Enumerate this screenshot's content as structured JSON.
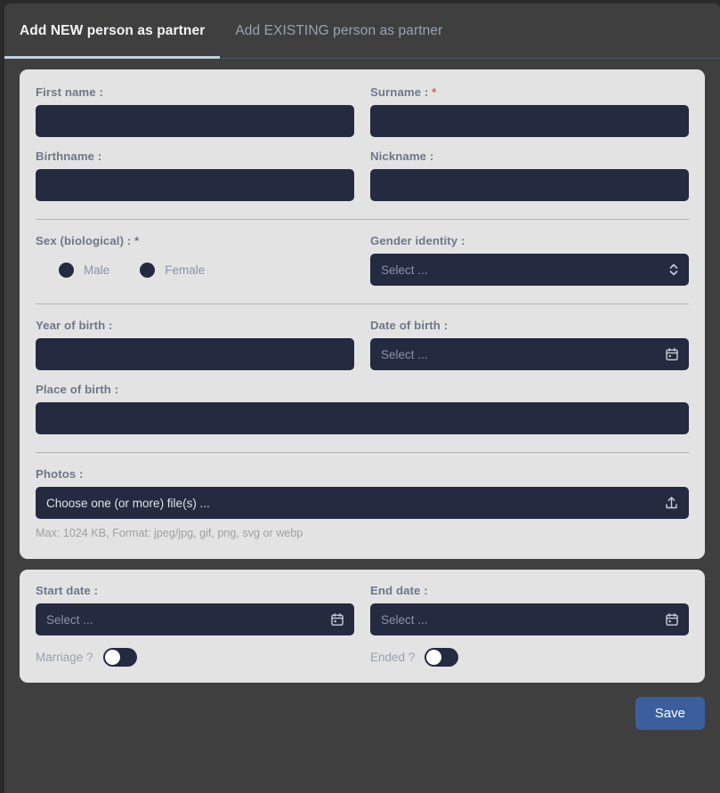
{
  "tabs": [
    {
      "label": "Add NEW person as partner",
      "active": true
    },
    {
      "label": "Add EXISTING person as partner",
      "active": false
    }
  ],
  "person_card": {
    "first_name": {
      "label": "First name :",
      "value": "",
      "placeholder": ""
    },
    "surname": {
      "label": "Surname :",
      "required_mark": "*",
      "value": "",
      "placeholder": ""
    },
    "birthname": {
      "label": "Birthname :",
      "value": "",
      "placeholder": ""
    },
    "nickname": {
      "label": "Nickname :",
      "value": "",
      "placeholder": ""
    },
    "sex": {
      "label": "Sex (biological) :",
      "required_mark": "*",
      "options": [
        {
          "label": "Male",
          "selected": false
        },
        {
          "label": "Female",
          "selected": false
        }
      ]
    },
    "gender_identity": {
      "label": "Gender identity :",
      "value": "Select ...",
      "icon": "chevron-up-down-icon"
    },
    "year_of_birth": {
      "label": "Year of birth :",
      "value": "",
      "placeholder": ""
    },
    "date_of_birth": {
      "label": "Date of birth :",
      "value": "Select ...",
      "icon": "calendar-icon"
    },
    "place_of_birth": {
      "label": "Place of birth :",
      "value": "",
      "placeholder": ""
    },
    "photos": {
      "label": "Photos :",
      "value": "Choose one (or more) file(s) ...",
      "icon": "upload-icon",
      "hint": "Max: 1024 KB, Format: jpeg/jpg, gif, png, svg or webp"
    }
  },
  "relation_card": {
    "start_date": {
      "label": "Start date :",
      "value": "Select ...",
      "icon": "calendar-icon"
    },
    "end_date": {
      "label": "End date :",
      "value": "Select ...",
      "icon": "calendar-icon"
    },
    "marriage": {
      "label": "Marriage ?",
      "on": false
    },
    "ended": {
      "label": "Ended ?",
      "on": false
    }
  },
  "actions": {
    "save_label": "Save"
  },
  "colors": {
    "page_bg": "#2b2b2b",
    "panel_bg": "#3f3f3f",
    "card_bg": "#e3e3e3",
    "input_bg": "#242b40",
    "label": "#6e7787",
    "placeholder": "#8b93a5",
    "accent_save": "#3b5f9c",
    "required_red": "#e05c5c",
    "tab_underline": "#c3d0dc"
  }
}
